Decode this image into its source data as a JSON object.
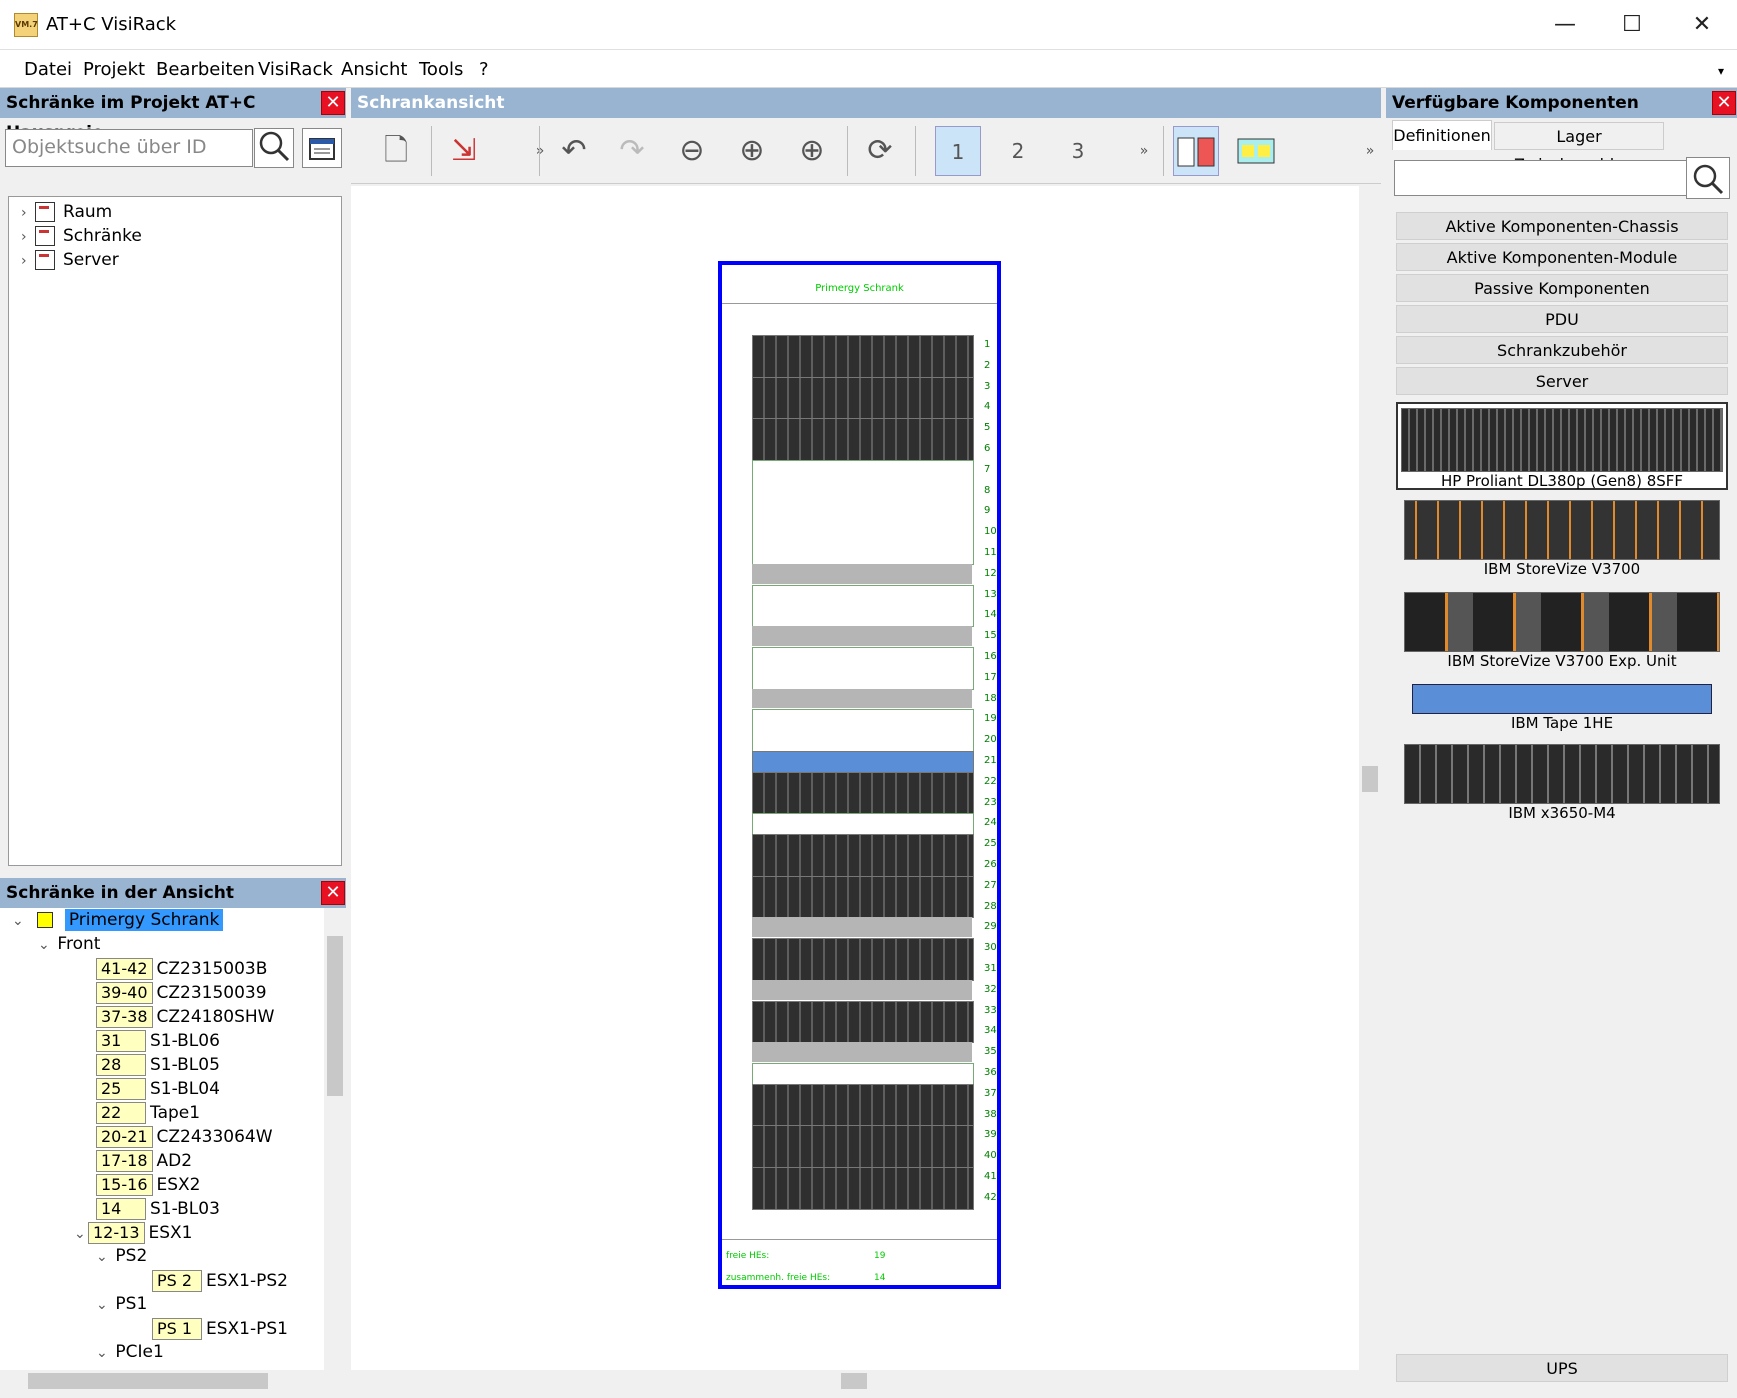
{
  "window": {
    "title": "AT+C VisiRack",
    "logo": "VM.7"
  },
  "menu": [
    "Datei",
    "Projekt",
    "Bearbeiten",
    "VisiRack",
    "Ansicht",
    "Tools",
    "?"
  ],
  "left_top": {
    "header": "Schränke im Projekt AT+C Hausproje",
    "search_placeholder": "Objektsuche über ID",
    "tree": [
      "Raum",
      "Schränke",
      "Server"
    ]
  },
  "left_bottom": {
    "header": "Schränke in der Ansicht",
    "root": "Primergy Schrank",
    "front": "Front",
    "items": [
      {
        "pos": "41-42",
        "id": "CZ2315003B"
      },
      {
        "pos": "39-40",
        "id": "CZ23150039"
      },
      {
        "pos": "37-38",
        "id": "CZ24180SHW"
      },
      {
        "pos": "31",
        "id": "S1-BL06"
      },
      {
        "pos": "28",
        "id": "S1-BL05"
      },
      {
        "pos": "25",
        "id": "S1-BL04"
      },
      {
        "pos": "22",
        "id": "Tape1"
      },
      {
        "pos": "20-21",
        "id": "CZ2433064W"
      },
      {
        "pos": "17-18",
        "id": "AD2"
      },
      {
        "pos": "15-16",
        "id": "ESX2"
      },
      {
        "pos": "14",
        "id": "S1-BL03"
      },
      {
        "pos": "12-13",
        "id": "ESX1"
      }
    ],
    "sub": {
      "ps2": "PS2",
      "ps2_badge": "PS 2",
      "ps2_id": "ESX1-PS2",
      "ps1": "PS1",
      "ps1_badge": "PS 1",
      "ps1_id": "ESX1-PS1",
      "pcie": "PCIe1"
    }
  },
  "center": {
    "header": "Schrankansicht",
    "rack_title": "Primergy Schrank",
    "units": [
      "1",
      "2",
      "3",
      "4",
      "5",
      "6",
      "7",
      "8",
      "9",
      "10",
      "11",
      "12",
      "13",
      "14",
      "15",
      "16",
      "17",
      "18",
      "19",
      "20",
      "21",
      "22",
      "23",
      "24",
      "25",
      "26",
      "27",
      "28",
      "29",
      "30",
      "31",
      "32",
      "33",
      "34",
      "35",
      "36",
      "37",
      "38",
      "39",
      "40",
      "41",
      "42"
    ],
    "stat1_label": "freie HEs:",
    "stat1_value": "19",
    "stat2_label": "zusammenh. freie HEs:",
    "stat2_value": "14"
  },
  "right": {
    "header": "Verfügbare Komponenten",
    "tabs": [
      "Definitionen",
      "Lager Zwischenablage"
    ],
    "categories": [
      "Aktive Komponenten-Chassis",
      "Aktive Komponenten-Module",
      "Passive Komponenten",
      "PDU",
      "Schrankzubehör",
      "Server"
    ],
    "components": [
      "HP Proliant DL380p (Gen8) 8SFF",
      "IBM StoreVize V3700",
      "IBM StoreVize V3700 Exp. Unit",
      "IBM Tape 1HE",
      "IBM x3650-M4"
    ],
    "bottom_category": "UPS"
  },
  "colors": {
    "panel_header": "#99b4d1",
    "rack_border": "#0000ff",
    "unit_text": "#008000",
    "close": "#e81123",
    "selection": "#3399ff"
  }
}
